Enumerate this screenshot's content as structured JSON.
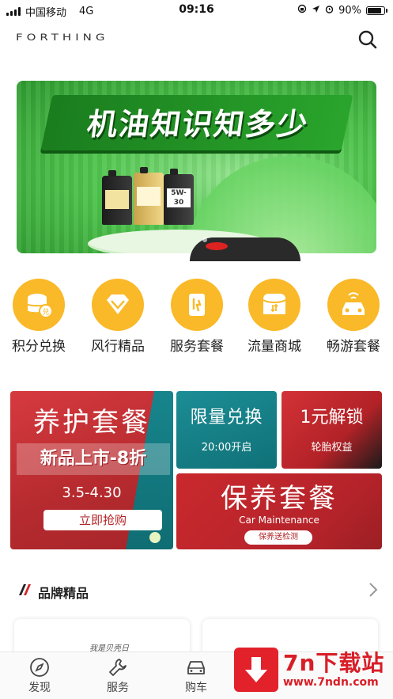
{
  "status_bar": {
    "carrier": "中国移动",
    "network": "4G",
    "time": "09:16",
    "battery_text": "90%",
    "battery_level": 0.9
  },
  "header": {
    "logo": "FORTHING",
    "search_icon": "search-icon"
  },
  "banner": {
    "title": "机油知识知多少",
    "bottle_labels": [
      "",
      "",
      "5W-30"
    ]
  },
  "quick_menu": [
    {
      "label": "积分兑换",
      "icon": "coin-stack-icon"
    },
    {
      "label": "风行精品",
      "icon": "diamond-icon"
    },
    {
      "label": "服务套餐",
      "icon": "service-package-icon"
    },
    {
      "label": "流量商城",
      "icon": "data-mall-icon"
    },
    {
      "label": "畅游套餐",
      "icon": "car-icon"
    }
  ],
  "promos": {
    "main": {
      "title": "养护套餐",
      "subtitle": "新品上市-8折",
      "date": "3.5-4.30",
      "button": "立即抢购"
    },
    "limited": {
      "title": "限量兑换",
      "subtitle": "20:00开启"
    },
    "unlock": {
      "title": "1元解锁",
      "subtitle": "轮胎权益"
    },
    "maintenance": {
      "title": "保养套餐",
      "subtitle_en": "Car Maintenance",
      "button": "保养送检测"
    }
  },
  "brand_section": {
    "title": "品牌精品",
    "card_text": "我是贝壳日"
  },
  "tab_bar": [
    {
      "label": "发现",
      "icon": "compass-icon"
    },
    {
      "label": "服务",
      "icon": "wrench-icon"
    },
    {
      "label": "购车",
      "icon": "car-front-icon"
    }
  ],
  "watermark": {
    "title": "7n下载站",
    "url": "www.7ndn.com"
  },
  "colors": {
    "accent_yellow": "#f9b928",
    "promo_red": "#c9292e",
    "promo_teal": "#17858c",
    "banner_green": "#4fc44d"
  }
}
